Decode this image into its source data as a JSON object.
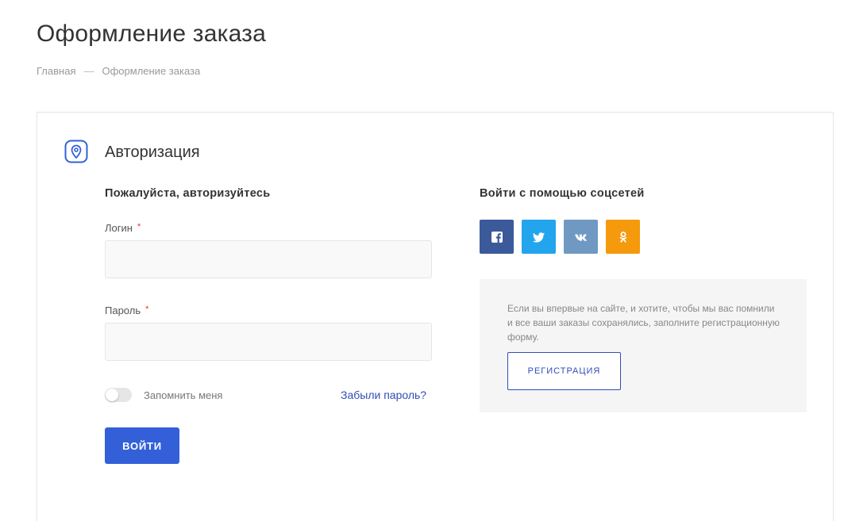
{
  "page": {
    "title": "Оформление заказа",
    "breadcrumb": [
      {
        "label": "Главная"
      },
      {
        "label": "Оформление заказа"
      }
    ],
    "breadcrumb_separator": "—"
  },
  "auth": {
    "title": "Авторизация",
    "icon": "map-pin-icon",
    "accent_color": "#3360d9"
  },
  "login_form": {
    "heading": "Пожалуйста, авторизуйтесь",
    "login_label": "Логин",
    "password_label": "Пароль",
    "required_mark": "*",
    "login_value": "",
    "password_value": "",
    "remember_label": "Запомнить меня",
    "remember_on": false,
    "forgot_label": "Забыли пароль?",
    "submit_label": "ВОЙТИ"
  },
  "social": {
    "heading": "Войти с помощью соцсетей",
    "networks": [
      {
        "name": "facebook",
        "icon": "facebook-icon",
        "color": "#3c5a99"
      },
      {
        "name": "twitter",
        "icon": "twitter-icon",
        "color": "#22a5ec"
      },
      {
        "name": "vk",
        "icon": "vk-icon",
        "color": "#6f99c2"
      },
      {
        "name": "odnoklassniki",
        "icon": "odnoklassniki-icon",
        "color": "#f59a0c"
      }
    ]
  },
  "registration": {
    "text": "Если вы впервые на сайте, и хотите, чтобы мы вас помнили и все ваши заказы сохранялись, заполните регистрационную форму.",
    "button_label": "РЕГИСТРАЦИЯ"
  }
}
